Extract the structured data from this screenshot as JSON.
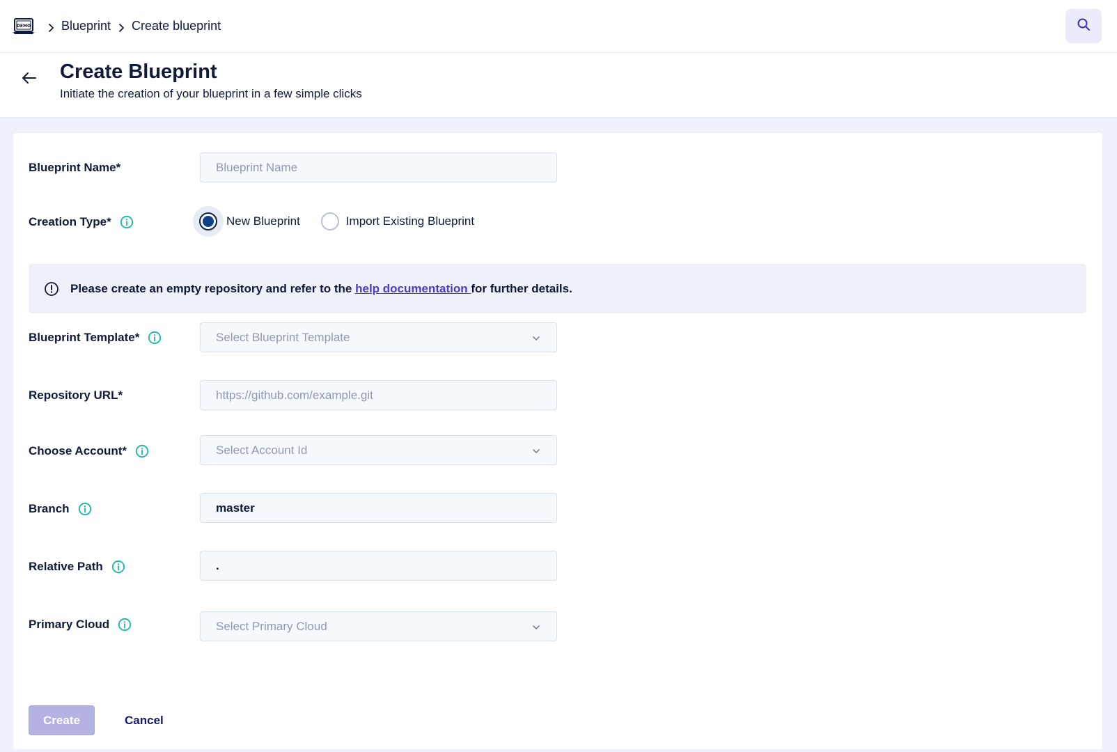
{
  "breadcrumb": {
    "items": [
      "Blueprint",
      "Create blueprint"
    ]
  },
  "header": {
    "title": "Create Blueprint",
    "subtitle": "Initiate the creation of your blueprint in a few simple clicks"
  },
  "form": {
    "blueprint_name": {
      "label": "Blueprint Name*",
      "placeholder": "Blueprint Name",
      "value": ""
    },
    "creation_type": {
      "label": "Creation Type*",
      "options": [
        "New Blueprint",
        "Import Existing Blueprint"
      ],
      "selected": "New Blueprint"
    },
    "alert": {
      "text_before": "Please create an empty repository and refer to the ",
      "link_text": "help documentation ",
      "text_after": "for further details."
    },
    "blueprint_template": {
      "label": "Blueprint Template*",
      "placeholder": "Select Blueprint Template"
    },
    "repository_url": {
      "label": "Repository URL*",
      "placeholder": "https://github.com/example.git",
      "value": ""
    },
    "choose_account": {
      "label": "Choose Account*",
      "placeholder": "Select Account Id"
    },
    "branch": {
      "label": "Branch",
      "value": "master"
    },
    "relative_path": {
      "label": "Relative Path",
      "value": "."
    },
    "primary_cloud": {
      "label": "Primary Cloud",
      "placeholder": "Select Primary Cloud"
    }
  },
  "actions": {
    "create_label": "Create",
    "cancel_label": "Cancel"
  },
  "colors": {
    "accent": "#4b3bd0",
    "info_icon": "#14b8a6",
    "radio_selected": "#0c4088",
    "create_disabled": "#b4b1e3"
  },
  "icons": [
    "demo-laptop-icon",
    "chevron-right-icon",
    "search-icon",
    "arrow-left-icon",
    "info-icon",
    "alert-circle-icon",
    "chevron-down-icon"
  ]
}
